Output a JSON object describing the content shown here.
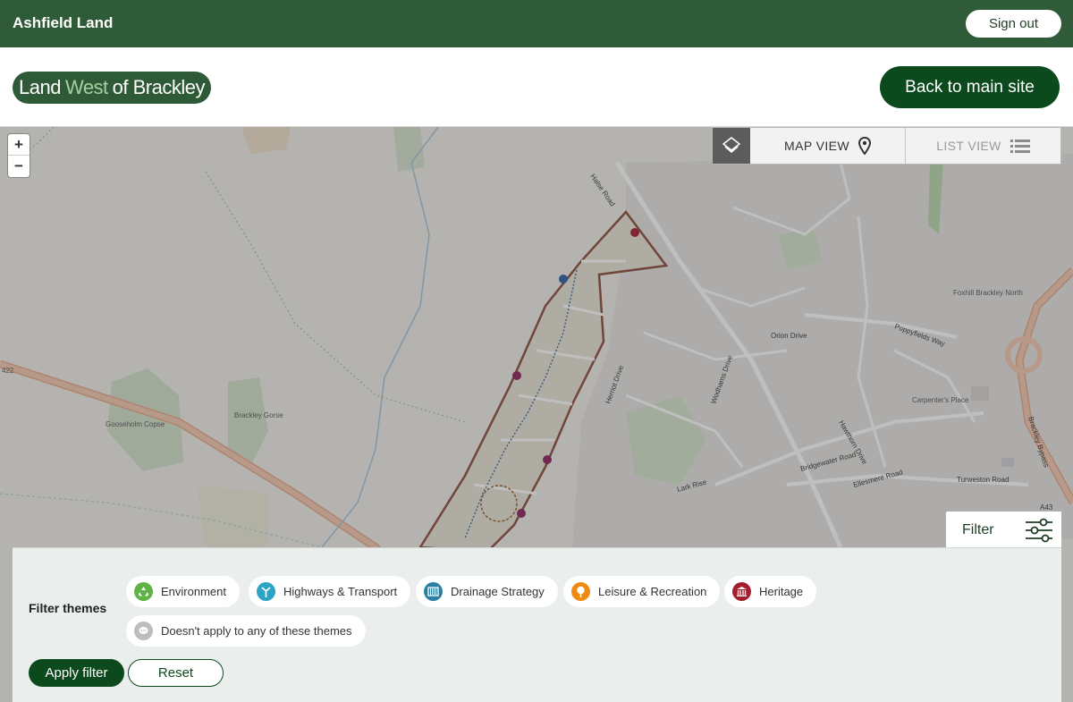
{
  "topbar": {
    "org_name": "Ashfield Land",
    "sign_out": "Sign out"
  },
  "header": {
    "logo": {
      "part1": "Land",
      "part2": "West",
      "part3": "of Brackley"
    },
    "back_button": "Back to main site"
  },
  "map": {
    "zoom_in": "+",
    "zoom_out": "−",
    "tabs": {
      "map_view": "MAP VIEW",
      "list_view": "LIST VIEW"
    },
    "labels": {
      "a422": "422",
      "halse_road": "Halse Road",
      "poppyfields": "Poppyfields Way",
      "orion_drive": "Orion Drive",
      "foxhill": "Foxhill Brackley North",
      "carpenters": "Carpenter's Place",
      "turweston": "Turweston Road",
      "bypass": "Brackley Bypass",
      "a43": "A43",
      "gosholm": "Gooseholm Copse",
      "brackley_gorse": "Brackley Gorse",
      "lark_rise": "Lark Rise",
      "bridgewater": "Bridgewater Road",
      "ellesmere": "Ellesmere Road",
      "wodhams": "Wodhams Drive",
      "herriot": "Herriot Drive",
      "hawthorn": "Hawthorn Drive"
    }
  },
  "filter": {
    "toggle_label": "Filter",
    "themes_label": "Filter themes",
    "themes": [
      {
        "label": "Environment",
        "color": "#5fb246",
        "icon": "recycle-icon"
      },
      {
        "label": "Highways & Transport",
        "color": "#2da3c6",
        "icon": "signpost-icon"
      },
      {
        "label": "Drainage Strategy",
        "color": "#2b7fa3",
        "icon": "drain-icon"
      },
      {
        "label": "Leisure & Recreation",
        "color": "#ef8a12",
        "icon": "tree-icon"
      },
      {
        "label": "Heritage",
        "color": "#a51d2d",
        "icon": "building-icon"
      },
      {
        "label": "Doesn't apply to any of these themes",
        "color": "#bdbdbd",
        "icon": "speech-icon"
      }
    ],
    "apply": "Apply filter",
    "reset": "Reset"
  },
  "colors": {
    "topbar": "#305b38",
    "primary": "#0c4a1d"
  }
}
